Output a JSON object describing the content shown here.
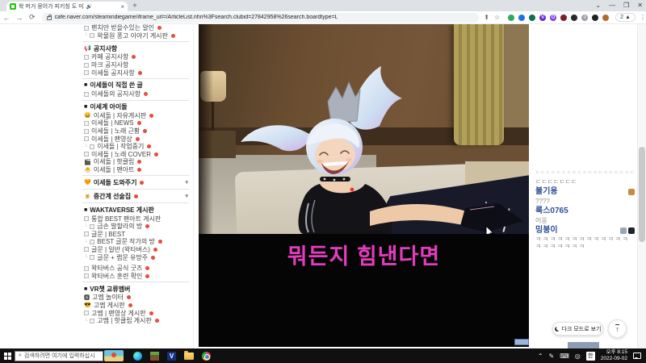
{
  "browser": {
    "tab_title": "왁 머거 뭉어가 피키칭 도 미",
    "tab_audio_icon": "speaker-icon",
    "new_tab_label": "+",
    "window_controls": {
      "tab_search": "⌄",
      "minimize": "—",
      "restore": "❐",
      "close": "✕"
    },
    "nav": {
      "back": "←",
      "forward": "→",
      "refresh": "⟳"
    },
    "url": "cafe.naver.com/steamindiegame/iframe_url=/ArticleList.nhn%3Fsearch.clubid=27842958%26search.boardtype=L",
    "share_icon": "⬆",
    "bookmark_icon": "☆",
    "profile_chip": "2",
    "menu_icon": "⋮",
    "extensions": [
      {
        "name": "ext-green",
        "color": "#2bab5c",
        "glyph": ""
      },
      {
        "name": "ext-blue",
        "color": "#1a73e8",
        "glyph": ""
      },
      {
        "name": "ext-teal",
        "color": "#0b6e4f",
        "glyph": ""
      },
      {
        "name": "ext-v",
        "color": "#6d28d9",
        "glyph": "V"
      },
      {
        "name": "ext-o",
        "color": "#7c3aed",
        "glyph": "O"
      },
      {
        "name": "ext-maroon",
        "color": "#7a1f2b",
        "glyph": ""
      },
      {
        "name": "ext-black",
        "color": "#26262b",
        "glyph": ""
      },
      {
        "name": "ext-list",
        "color": "#9aa0a6",
        "glyph": "≡"
      },
      {
        "name": "ext-bw",
        "color": "#202124",
        "glyph": ""
      },
      {
        "name": "ext-avatar",
        "color": "#b06a2c",
        "glyph": ""
      }
    ]
  },
  "sidebar": {
    "items": [
      {
        "t": "i",
        "label": "팬치만 받을수있는 알인",
        "dot": 1
      },
      {
        "t": "i",
        "label": "왁물원 퐁고 이야기 게시판",
        "dot": 1,
        "sub": 1
      },
      {
        "t": "d"
      },
      {
        "t": "hi",
        "emoji": "📢",
        "label": "공지사항"
      },
      {
        "t": "i",
        "label": "카페 공지사항",
        "dot": 1
      },
      {
        "t": "i",
        "label": "마크 공지사항"
      },
      {
        "t": "i",
        "label": "이세돌 공지사항",
        "dot": 1
      },
      {
        "t": "d"
      },
      {
        "t": "h",
        "label": "이세돌이 직접 쓴 글"
      },
      {
        "t": "i",
        "label": "이세돌의 공지사항",
        "dot": 1
      },
      {
        "t": "d"
      },
      {
        "t": "h",
        "label": "이세계 아이돌"
      },
      {
        "t": "i",
        "emoji": "😄",
        "label": "이세돌 | 자유게시판",
        "dot": 1
      },
      {
        "t": "i",
        "label": "이세돌 | NEWS",
        "dot": 1
      },
      {
        "t": "i",
        "label": "이세돌 | 노래 근황",
        "dot": 1
      },
      {
        "t": "i",
        "label": "이세돌 | 팬영상",
        "dot": 1
      },
      {
        "t": "i",
        "label": "이세돌 | 작업중기",
        "dot": 1,
        "sub": 1
      },
      {
        "t": "i",
        "label": "이세돌 | 노래 COVER",
        "dot": 1
      },
      {
        "t": "i",
        "emoji": "🎬",
        "label": "이세돌 | 핫클립",
        "dot": 1
      },
      {
        "t": "i",
        "emoji": "🐣",
        "label": "이세돌 | 팬아트",
        "dot": 1
      },
      {
        "t": "d"
      },
      {
        "t": "c",
        "emoji": "🧡",
        "label": "이세돌 도와주기",
        "dot": 1,
        "caret": "▾"
      },
      {
        "t": "d"
      },
      {
        "t": "c",
        "emoji": "🍺",
        "label": "중간계 선술집",
        "dot": 1,
        "caret": "▾"
      },
      {
        "t": "d"
      },
      {
        "t": "h",
        "label": "WAKTAVERSE 게시판"
      },
      {
        "t": "i",
        "label": "통합 BEST 팬아트 게시판"
      },
      {
        "t": "i",
        "label": "금손 발할라의 방",
        "dot": 1,
        "sub": 1
      },
      {
        "t": "i",
        "label": "글문 | BEST"
      },
      {
        "t": "i",
        "label": "BEST 글문 작가의 방",
        "dot": 1,
        "sub": 1
      },
      {
        "t": "i",
        "label": "글문 | 일반 (왁타버스)",
        "dot": 1
      },
      {
        "t": "i",
        "label": "글문 + 랩문 유망주",
        "dot": 1,
        "sub": 1
      },
      {
        "t": "s"
      },
      {
        "t": "i",
        "label": "왁타버스 공식 굿즈",
        "dot": 1
      },
      {
        "t": "i",
        "label": "왁타버스 훈련 확인",
        "dot": 1
      },
      {
        "t": "d"
      },
      {
        "t": "h",
        "label": "VR챗 교류멤버"
      },
      {
        "t": "i",
        "emoji": "🅰",
        "label": "고멤 놀이터",
        "dot": 1
      },
      {
        "t": "i",
        "emoji": "😎",
        "label": "고멤 게시판",
        "dot": 1
      },
      {
        "t": "i",
        "label": "고멤 | 팬영상 게시판",
        "dot": 1
      },
      {
        "t": "i",
        "label": "고멤 | 핫클립 게시판",
        "dot": 1,
        "sub": 1
      }
    ]
  },
  "video": {
    "caption": "뭐든지 힘낸다면",
    "caption_color": "#e33dbd"
  },
  "comments": {
    "rows": [
      {
        "type": "text",
        "muted": true,
        "text": "ㄷㄷㄷㄷㄷㄷㄷㄷㄷㄷㄷㄷㄷㄷㄷㄷㄷㄷㄷㄷㄷㄷㄷㄷㄷㄷㄷㄷㄷㄷ"
      },
      {
        "type": "text",
        "text": "ㄷㄷㄷㄷㄷㄷㄷ"
      },
      {
        "type": "name",
        "name": "불기용",
        "badges": [
          "#c98a3f"
        ]
      },
      {
        "type": "text",
        "text": "????"
      },
      {
        "type": "name",
        "name": "룩스0765",
        "badges": []
      },
      {
        "type": "text",
        "text": "어옹"
      },
      {
        "type": "name",
        "name": "밍붕이",
        "badges": [
          "#9aa7b8",
          "#20242c"
        ]
      },
      {
        "type": "text",
        "wrap": true,
        "text": "ㅋㅋㅋㅋㅋㅋㅋㅋㅋㅋㅋㅋㅋㅋㅋㅋㅋㅋㅋㅋ"
      }
    ],
    "dark_mode_label": "다크 모드로 보기",
    "scroll_top_icon": "↑"
  },
  "taskbar": {
    "search_placeholder": "검색하려면 여기에 입력하십시",
    "tray": {
      "ime": "한",
      "time": "오후 8:15",
      "date": "2022-09-02"
    }
  }
}
